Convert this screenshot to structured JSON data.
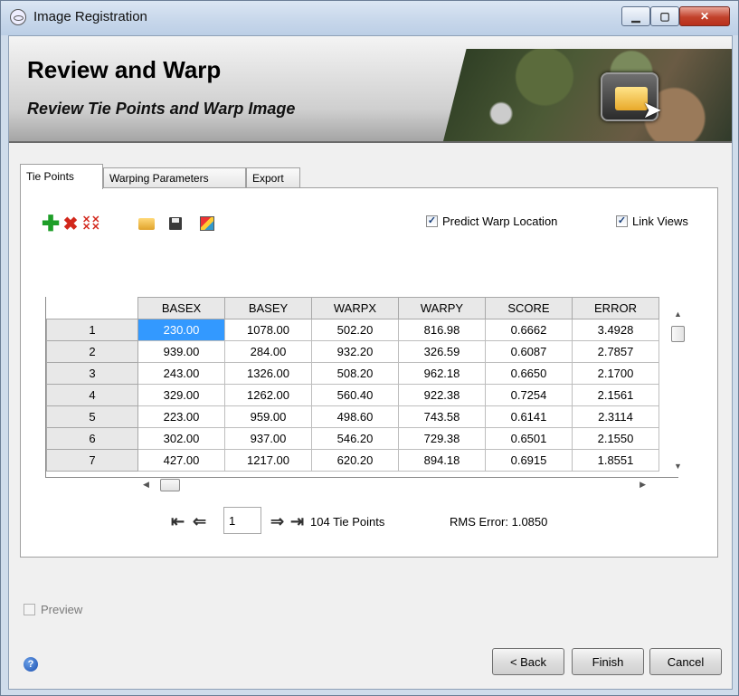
{
  "window": {
    "title": "Image Registration",
    "minimize_glyph": "▁",
    "maximize_glyph": "▢",
    "close_glyph": "✕"
  },
  "banner": {
    "title": "Review and Warp",
    "subtitle": "Review Tie Points and Warp Image"
  },
  "tabs": [
    {
      "label": "Tie Points",
      "active": true
    },
    {
      "label": "Warping Parameters",
      "active": false
    },
    {
      "label": "Export",
      "active": false
    }
  ],
  "toolbar": {
    "add_icon": "plus-icon",
    "delete_icon": "delete-icon",
    "delete_all_icon": "delete-all-icon",
    "open_icon": "folder-open-icon",
    "save_icon": "save-icon",
    "layer_icon": "layer-icon",
    "add_glyph": "✚",
    "delete_glyph": "✖",
    "delete_all_glyph": "✕✕ ✕✕"
  },
  "options": {
    "predict_warp_label": "Predict Warp Location",
    "predict_warp_checked": true,
    "link_views_label": "Link Views",
    "link_views_checked": true,
    "check_glyph": "✓"
  },
  "table": {
    "columns": [
      "BASEX",
      "BASEY",
      "WARPX",
      "WARPY",
      "SCORE",
      "ERROR"
    ],
    "rows": [
      [
        "1",
        "230.00",
        "1078.00",
        "502.20",
        "816.98",
        "0.6662",
        "3.4928"
      ],
      [
        "2",
        "939.00",
        "284.00",
        "932.20",
        "326.59",
        "0.6087",
        "2.7857"
      ],
      [
        "3",
        "243.00",
        "1326.00",
        "508.20",
        "962.18",
        "0.6650",
        "2.1700"
      ],
      [
        "4",
        "329.00",
        "1262.00",
        "560.40",
        "922.38",
        "0.7254",
        "2.1561"
      ],
      [
        "5",
        "223.00",
        "959.00",
        "498.60",
        "743.58",
        "0.6141",
        "2.3114"
      ],
      [
        "6",
        "302.00",
        "937.00",
        "546.20",
        "729.38",
        "0.6501",
        "2.1550"
      ],
      [
        "7",
        "427.00",
        "1217.00",
        "620.20",
        "894.18",
        "0.6915",
        "1.8551"
      ]
    ],
    "selected_cell": "230.00"
  },
  "pager": {
    "first_glyph": "⇤",
    "prev_glyph": "⇐",
    "next_glyph": "⇒",
    "last_glyph": "⇥",
    "page_value": "1",
    "tie_points_label": "104 Tie Points",
    "rms_label": "RMS Error: 1.0850"
  },
  "footer": {
    "preview_label": "Preview",
    "preview_checked": false,
    "help_glyph": "?",
    "back_label": "< Back",
    "finish_label": "Finish",
    "cancel_label": "Cancel"
  }
}
